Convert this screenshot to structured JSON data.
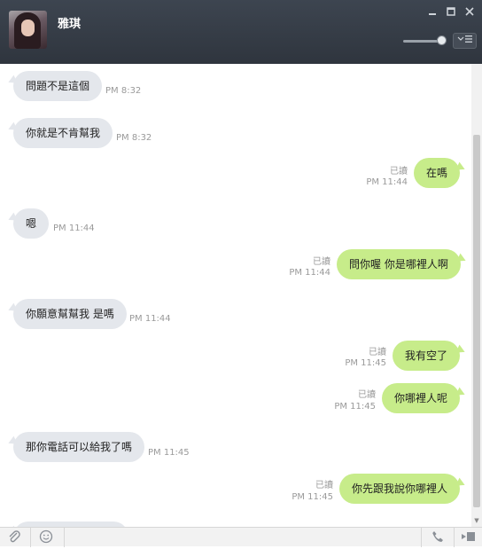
{
  "header": {
    "contact_name": "雅琪",
    "minimize_icon": "minimize-icon",
    "maximize_icon": "maximize-icon",
    "close_icon": "close-icon",
    "menu_icon": "menu-icon"
  },
  "messages": [
    {
      "dir": "recv",
      "text": "問題不是這個",
      "time": "PM 8:32"
    },
    {
      "dir": "recv",
      "text": "你就是不肯幫我",
      "time": "PM 8:32"
    },
    {
      "dir": "sent",
      "text": "在嗎",
      "time": "PM 11:44",
      "read": "已讀"
    },
    {
      "dir": "recv",
      "text": "嗯",
      "time": "PM 11:44"
    },
    {
      "dir": "sent",
      "text": "問你喔 你是哪裡人啊",
      "time": "PM 11:44",
      "read": "已讀"
    },
    {
      "dir": "recv",
      "text": "你願意幫幫我 是嗎",
      "time": "PM 11:44"
    },
    {
      "dir": "sent",
      "text": "我有空了",
      "time": "PM 11:45",
      "read": "已讀"
    },
    {
      "dir": "sent",
      "text": "你哪裡人呢",
      "time": "PM 11:45",
      "read": "已讀"
    },
    {
      "dir": "recv",
      "text": "那你電話可以給我了嗎",
      "time": "PM 11:45"
    },
    {
      "dir": "sent",
      "text": "你先跟我說你哪裡人",
      "time": "PM 11:45",
      "read": "已讀"
    }
  ],
  "toolbar": {
    "icons": [
      "attachment-icon",
      "emoji-icon",
      "phone-icon",
      "video-icon"
    ]
  },
  "colors": {
    "header_bg": "#353c45",
    "sent_bubble": "#c7ec8a",
    "recv_bubble": "#e4e7ec"
  }
}
